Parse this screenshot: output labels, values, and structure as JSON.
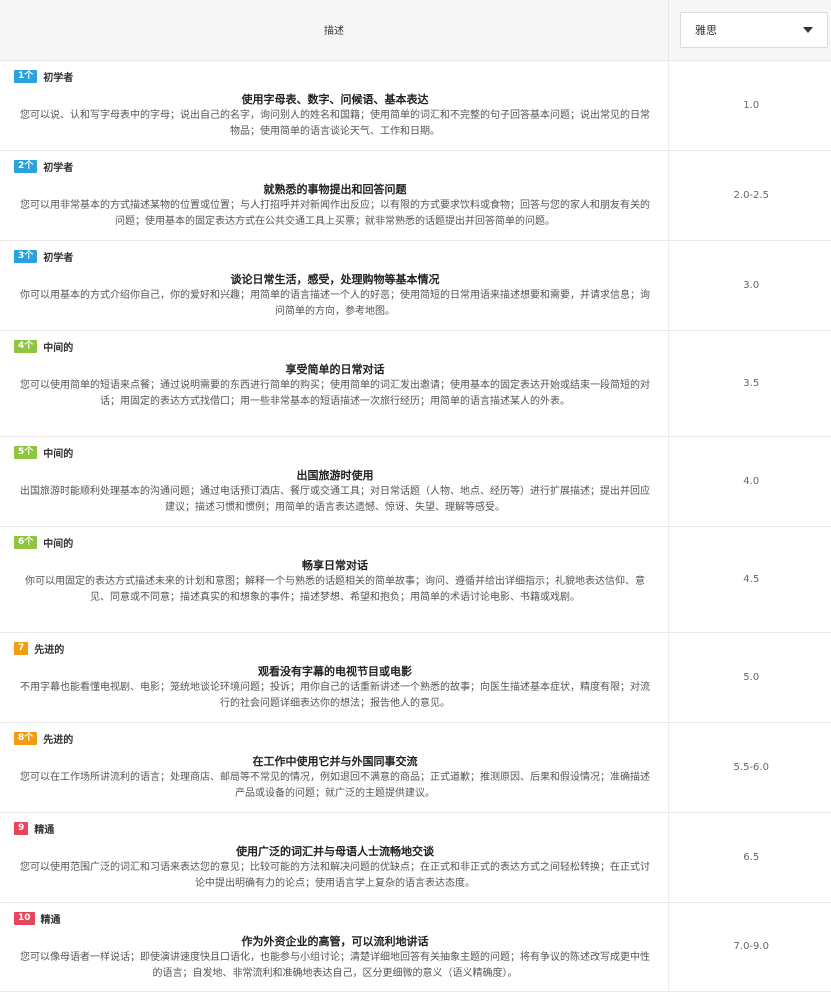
{
  "header": {
    "description_label": "描述",
    "exam_select": "雅思"
  },
  "colors": {
    "blue": "#29a3e0",
    "green": "#8dc63f",
    "orange": "#f39c12",
    "red": "#e8445a"
  },
  "rows": [
    {
      "badge": "1个",
      "level": "初学者",
      "title": "使用字母表、数字、问候语、基本表达",
      "text": "您可以说、认和写字母表中的字母；说出自己的名字，询问别人的姓名和国籍；使用简单的词汇和不完整的句子回答基本问题；说出常见的日常物品；使用简单的语言谈论天气、工作和日期。",
      "score": "1.0"
    },
    {
      "badge": "2个",
      "level": "初学者",
      "title": "就熟悉的事物提出和回答问题",
      "text": "您可以用非常基本的方式描述某物的位置或位置；与人打招呼并对新闻作出反应；以有限的方式要求饮料或食物；回答与您的家人和朋友有关的问题；使用基本的固定表达方式在公共交通工具上买票；就非常熟悉的话题提出并回答简单的问题。",
      "score": "2.0-2.5"
    },
    {
      "badge": "3个",
      "level": "初学者",
      "title": "谈论日常生活，感受，处理购物等基本情况",
      "text": "你可以用基本的方式介绍你自己，你的爱好和兴趣；用简单的语言描述一个人的好恶；使用简短的日常用语来描述想要和需要，并请求信息；询问简单的方向，参考地图。",
      "score": "3.0"
    },
    {
      "badge": "4个",
      "level": "中间的",
      "title": "享受简单的日常对话",
      "text": "您可以使用简单的短语来点餐；通过说明需要的东西进行简单的购买；使用简单的词汇发出邀请；使用基本的固定表达开始或结束一段简短的对话；用固定的表达方式找借口；用一些非常基本的短语描述一次旅行经历；用简单的语言描述某人的外表。",
      "score": "3.5"
    },
    {
      "badge": "5个",
      "level": "中间的",
      "title": "出国旅游时使用",
      "text": "出国旅游时能顺利处理基本的沟通问题；通过电话预订酒店、餐厅或交通工具；对日常话题（人物、地点、经历等）进行扩展描述；提出并回应建议；描述习惯和惯例；用简单的语言表达遗憾、惊讶、失望、理解等感受。",
      "score": "4.0"
    },
    {
      "badge": "6个",
      "level": "中间的",
      "title": "畅享日常对话",
      "text": "你可以用固定的表达方式描述未来的计划和意图；解释一个与熟悉的话题相关的简单故事；询问、遵循并给出详细指示；礼貌地表达信仰、意见、同意或不同意；描述真实的和想象的事件；描述梦想、希望和抱负；用简单的术语讨论电影、书籍或戏剧。",
      "score": "4.5"
    },
    {
      "badge": "7",
      "level": "先进的",
      "title": "观看没有字幕的电视节目或电影",
      "text": "不用字幕也能看懂电视剧、电影；笼统地谈论环境问题；投诉；用你自己的话重新讲述一个熟悉的故事；向医生描述基本症状，精度有限；对流行的社会问题详细表达你的想法；报告他人的意见。",
      "score": "5.0"
    },
    {
      "badge": "8个",
      "level": "先进的",
      "title": "在工作中使用它并与外国同事交流",
      "text": "您可以在工作场所讲流利的语言；处理商店、邮局等不常见的情况，例如退回不满意的商品；正式道歉；推测原因、后果和假设情况；准确描述产品或设备的问题；就广泛的主题提供建议。",
      "score": "5.5-6.0"
    },
    {
      "badge": "9",
      "level": "精通",
      "title": "使用广泛的词汇并与母语人士流畅地交谈",
      "text": "您可以使用范围广泛的词汇和习语来表达您的意见；比较可能的方法和解决问题的优缺点；在正式和非正式的表达方式之间轻松转换；在正式讨论中提出明确有力的论点；使用语言学上复杂的语言表达态度。",
      "score": "6.5"
    },
    {
      "badge": "10",
      "level": "精通",
      "title": "作为外资企业的高管，可以流利地讲话",
      "text": "您可以像母语者一样说话；即使演讲速度快且口语化，也能参与小组讨论；清楚详细地回答有关抽象主题的问题；将有争议的陈述改写成更中性的语言；自发地、非常流利和准确地表达自己，区分更细微的意义（语义精确度）。",
      "score": "7.0-9.0"
    }
  ]
}
